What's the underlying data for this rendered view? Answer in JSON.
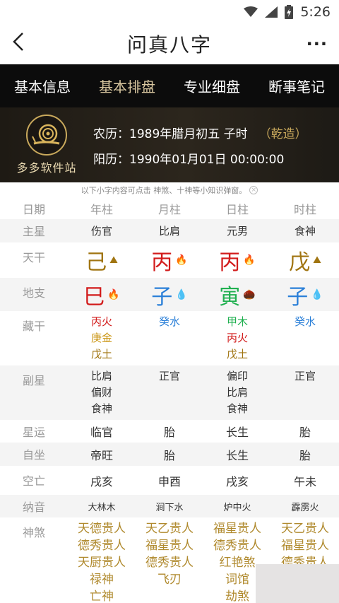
{
  "status": {
    "time": "5:26"
  },
  "appbar": {
    "title": "问真八字",
    "back": "<",
    "more": "···"
  },
  "tabs": [
    "基本信息",
    "基本排盘",
    "专业细盘",
    "断事笔记"
  ],
  "profile": {
    "brand": "多多软件站",
    "lunar": "农历：1989年腊月初五 子时",
    "qianzao": "（乾造）",
    "solar": "阳历：1990年01月01日 00:00:00"
  },
  "notice": "以下小字内容可点击 神煞、十神等小知识弹窗。",
  "table": {
    "headers": [
      "日期",
      "年柱",
      "月柱",
      "日柱",
      "时柱"
    ],
    "zhuxing": {
      "label": "主星",
      "cells": [
        "伤官",
        "比肩",
        "元男",
        "食神"
      ]
    },
    "tiangan": {
      "label": "天干",
      "cells": [
        "己",
        "丙",
        "丙",
        "戊"
      ]
    },
    "dizhi": {
      "label": "地支",
      "cells": [
        "巳",
        "子",
        "寅",
        "子"
      ]
    },
    "canggan": {
      "label": "藏干",
      "cells": [
        [
          "丙火",
          "庚金",
          "戊土"
        ],
        [
          "癸水"
        ],
        [
          "甲木",
          "丙火",
          "戊土"
        ],
        [
          "癸水"
        ]
      ]
    },
    "fuxing": {
      "label": "副星",
      "cells": [
        [
          "比肩",
          "偏财",
          "食神"
        ],
        [
          "正官"
        ],
        [
          "偏印",
          "比肩",
          "食神"
        ],
        [
          "正官"
        ]
      ]
    },
    "xingyun": {
      "label": "星运",
      "cells": [
        "临官",
        "胎",
        "长生",
        "胎"
      ]
    },
    "zizuo": {
      "label": "自坐",
      "cells": [
        "帝旺",
        "胎",
        "长生",
        "胎"
      ]
    },
    "kongwang": {
      "label": "空亡",
      "cells": [
        "戌亥",
        "申酉",
        "戌亥",
        "午未"
      ]
    },
    "nayin": {
      "label": "纳音",
      "cells": [
        "大林木",
        "涧下水",
        "炉中火",
        "霹雳火"
      ]
    },
    "shensha": {
      "label": "神煞",
      "cells": [
        [
          "天德贵人",
          "德秀贵人",
          "天厨贵人",
          "禄神",
          "亡神"
        ],
        [
          "天乙贵人",
          "福星贵人",
          "德秀贵人",
          "飞刃"
        ],
        [
          "福星贵人",
          "德秀贵人",
          "红艳煞",
          "词馆",
          "劫煞"
        ],
        [
          "天乙贵人",
          "福星贵人",
          "德秀贵人"
        ]
      ]
    }
  },
  "colors": {
    "brown": "#a07410",
    "red": "#d21b1b",
    "blue": "#2a7fd8",
    "green": "#20b050",
    "gold": "#b08a2e"
  }
}
